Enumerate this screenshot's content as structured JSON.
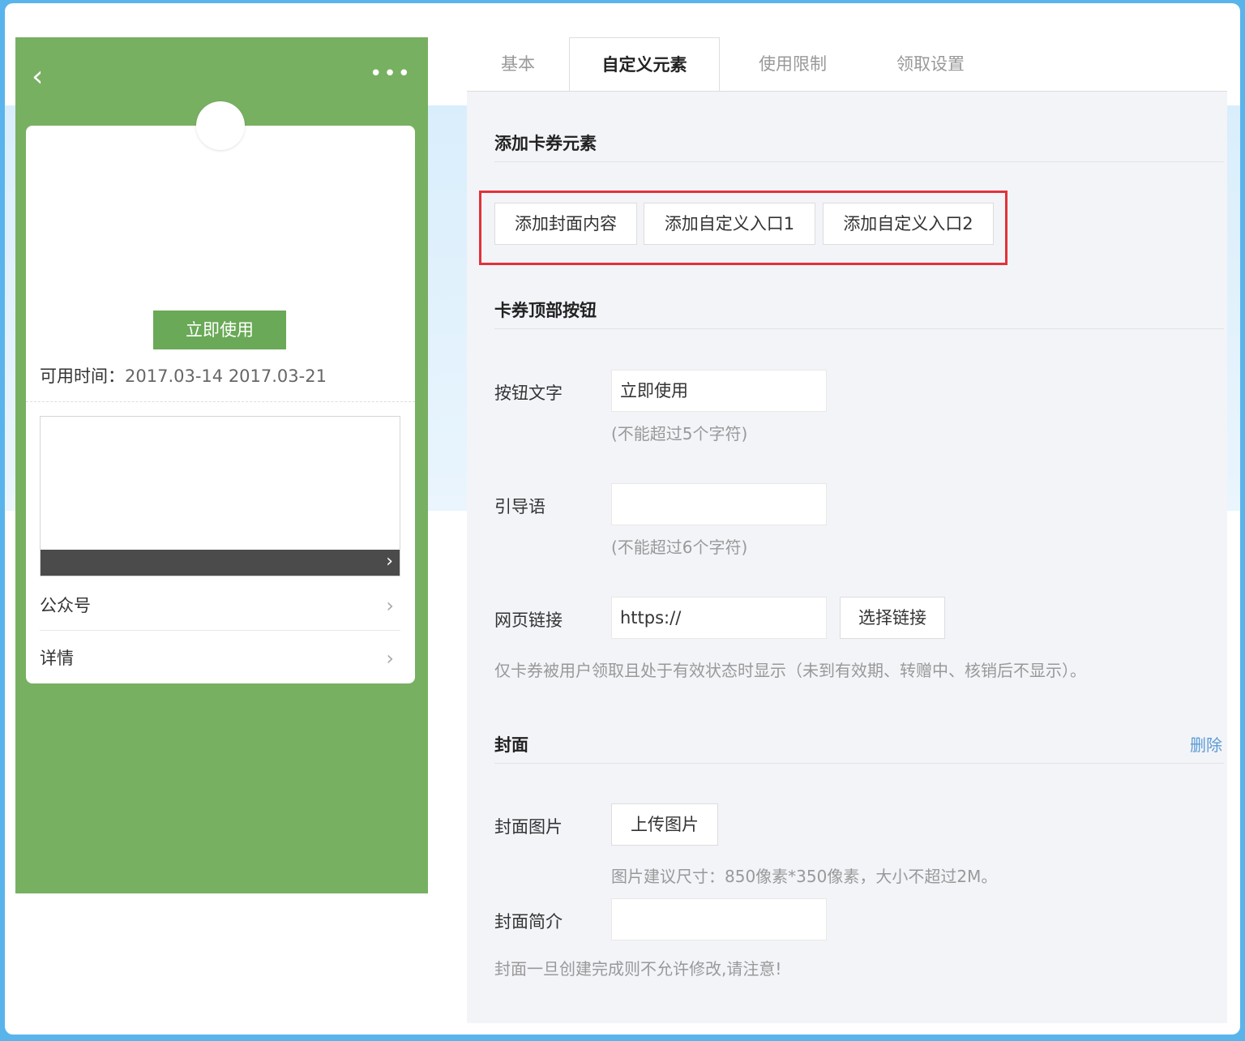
{
  "phone": {
    "back_icon": "chevron-left-icon",
    "more_icon": "more-dots-icon",
    "use_button": "立即使用",
    "avail_label": "可用时间：",
    "avail_value": "2017.03-14 2017.03-21",
    "rows": [
      "公众号",
      "详情"
    ]
  },
  "tabs": [
    "基本",
    "自定义元素",
    "使用限制",
    "领取设置"
  ],
  "active_tab": "自定义元素",
  "sections": {
    "add_elements": {
      "title": "添加卡券元素",
      "buttons": [
        "添加封面内容",
        "添加自定义入口1",
        "添加自定义入口2"
      ]
    },
    "top_button": {
      "title": "卡券顶部按钮",
      "button_text_label": "按钮文字",
      "button_text_value": "立即使用",
      "button_text_hint": "(不能超过5个字符)",
      "guide_label": "引导语",
      "guide_value": "",
      "guide_hint": "(不能超过6个字符)",
      "link_label": "网页链接",
      "link_value": "https://",
      "select_link_button": "选择链接",
      "link_note": "仅卡券被用户领取且处于有效状态时显示（未到有效期、转赠中、核销后不显示）。"
    },
    "cover": {
      "title": "封面",
      "delete": "删除",
      "image_label": "封面图片",
      "upload_button": "上传图片",
      "image_hint": "图片建议尺寸：850像素*350像素，大小不超过2M。",
      "intro_label": "封面简介",
      "intro_value": "",
      "note": "封面一旦创建完成则不允许修改,请注意!"
    }
  },
  "colors": {
    "phone_green": "#78b062",
    "button_green": "#6aa957",
    "highlight_red": "#e2323a",
    "link_blue": "#5b9bd5"
  }
}
